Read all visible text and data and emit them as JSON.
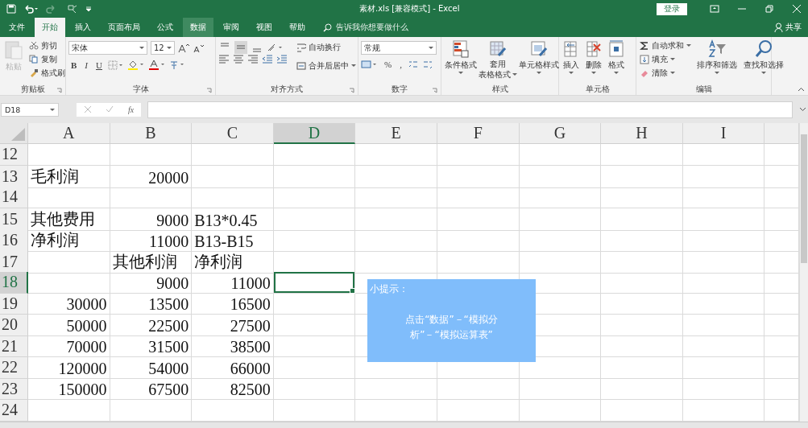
{
  "title_bar": {
    "title": "素材.xls  [兼容模式]  -  Excel",
    "sign_in": "登录"
  },
  "tabs": [
    {
      "label": "文件",
      "selected": false,
      "hover": false
    },
    {
      "label": "开始",
      "selected": true,
      "hover": false
    },
    {
      "label": "插入",
      "selected": false,
      "hover": false
    },
    {
      "label": "页面布局",
      "selected": false,
      "hover": false
    },
    {
      "label": "公式",
      "selected": false,
      "hover": false
    },
    {
      "label": "数据",
      "selected": false,
      "hover": true
    },
    {
      "label": "审阅",
      "selected": false,
      "hover": false
    },
    {
      "label": "视图",
      "selected": false,
      "hover": false
    },
    {
      "label": "帮助",
      "selected": false,
      "hover": false
    }
  ],
  "search": {
    "placeholder": "告诉我你想要做什么"
  },
  "share": "共享",
  "ribbon": {
    "clipboard": {
      "label": "剪贴板",
      "paste": {
        "label": "粘贴",
        "disabled": true
      },
      "cut": "剪切",
      "copy": "复制",
      "format_painter": "格式刷"
    },
    "font": {
      "label": "字体",
      "font_name": "宋体",
      "font_size": "12",
      "bold": "B",
      "italic": "I",
      "underline": "U"
    },
    "alignment": {
      "label": "对齐方式",
      "vertical": [
        {
          "selected": false
        },
        {
          "selected": true
        },
        {
          "selected": false
        }
      ],
      "wrap_text": "自动换行",
      "merge_center": "合并后居中"
    },
    "number": {
      "label": "数字",
      "format": "常规",
      "percent": "%",
      "comma": ","
    },
    "styles": {
      "label": "样式",
      "conditional": "条件格式",
      "table_format": [
        "套用",
        "表格格式"
      ],
      "cell_style": "单元格样式"
    },
    "cells": {
      "label": "单元格",
      "insert": "插入",
      "delete": "删除",
      "format": "格式"
    },
    "editing": {
      "label": "编辑",
      "autosum": "自动求和",
      "fill": "填充",
      "clear": "清除",
      "sort_filter": "排序和筛选",
      "find_select": "查找和选择"
    }
  },
  "formula_bar": {
    "name_box": "D18",
    "fx": "fx"
  },
  "grid": {
    "columns": [
      {
        "label": "A",
        "selected": false
      },
      {
        "label": "B",
        "selected": false
      },
      {
        "label": "C",
        "selected": false
      },
      {
        "label": "D",
        "selected": true
      },
      {
        "label": "E",
        "selected": false
      },
      {
        "label": "F",
        "selected": false
      },
      {
        "label": "G",
        "selected": false
      },
      {
        "label": "H",
        "selected": false
      },
      {
        "label": "I",
        "selected": false
      }
    ],
    "rows": [
      {
        "label": "12",
        "selected": false,
        "cells": []
      },
      {
        "label": "13",
        "selected": false,
        "cells": [
          {
            "text": "毛利润",
            "kind": "text"
          },
          {
            "text": "20000",
            "kind": "number"
          }
        ]
      },
      {
        "label": "14",
        "selected": false,
        "cells": []
      },
      {
        "label": "15",
        "selected": false,
        "cells": [
          {
            "text": "其他费用",
            "kind": "text"
          },
          {
            "text": "9000",
            "kind": "number"
          },
          {
            "text": "B13*0.45",
            "kind": "text"
          }
        ]
      },
      {
        "label": "16",
        "selected": false,
        "cells": [
          {
            "text": "净利润",
            "kind": "text"
          },
          {
            "text": "11000",
            "kind": "number"
          },
          {
            "text": "B13-B15",
            "kind": "text"
          }
        ]
      },
      {
        "label": "17",
        "selected": false,
        "cells": [
          null,
          {
            "text": "其他利润",
            "kind": "text"
          },
          {
            "text": "净利润",
            "kind": "text"
          }
        ]
      },
      {
        "label": "18",
        "selected": true,
        "cells": [
          null,
          {
            "text": "9000",
            "kind": "number"
          },
          {
            "text": "11000",
            "kind": "number"
          }
        ]
      },
      {
        "label": "19",
        "selected": false,
        "cells": [
          {
            "text": "30000",
            "kind": "number"
          },
          {
            "text": "13500",
            "kind": "number"
          },
          {
            "text": "16500",
            "kind": "number"
          }
        ]
      },
      {
        "label": "20",
        "selected": false,
        "cells": [
          {
            "text": "50000",
            "kind": "number"
          },
          {
            "text": "22500",
            "kind": "number"
          },
          {
            "text": "27500",
            "kind": "number"
          }
        ]
      },
      {
        "label": "21",
        "selected": false,
        "cells": [
          {
            "text": "70000",
            "kind": "number"
          },
          {
            "text": "31500",
            "kind": "number"
          },
          {
            "text": "38500",
            "kind": "number"
          }
        ]
      },
      {
        "label": "22",
        "selected": false,
        "cells": [
          {
            "text": "120000",
            "kind": "number"
          },
          {
            "text": "54000",
            "kind": "number"
          },
          {
            "text": "66000",
            "kind": "number"
          }
        ]
      },
      {
        "label": "23",
        "selected": false,
        "cells": [
          {
            "text": "150000",
            "kind": "number"
          },
          {
            "text": "67500",
            "kind": "number"
          },
          {
            "text": "82500",
            "kind": "number"
          }
        ]
      },
      {
        "label": "24",
        "selected": false,
        "cells": []
      }
    ]
  },
  "tip": {
    "title": "小提示：",
    "text": "点击“数据”－“模拟分析”－“模拟运算表”"
  }
}
